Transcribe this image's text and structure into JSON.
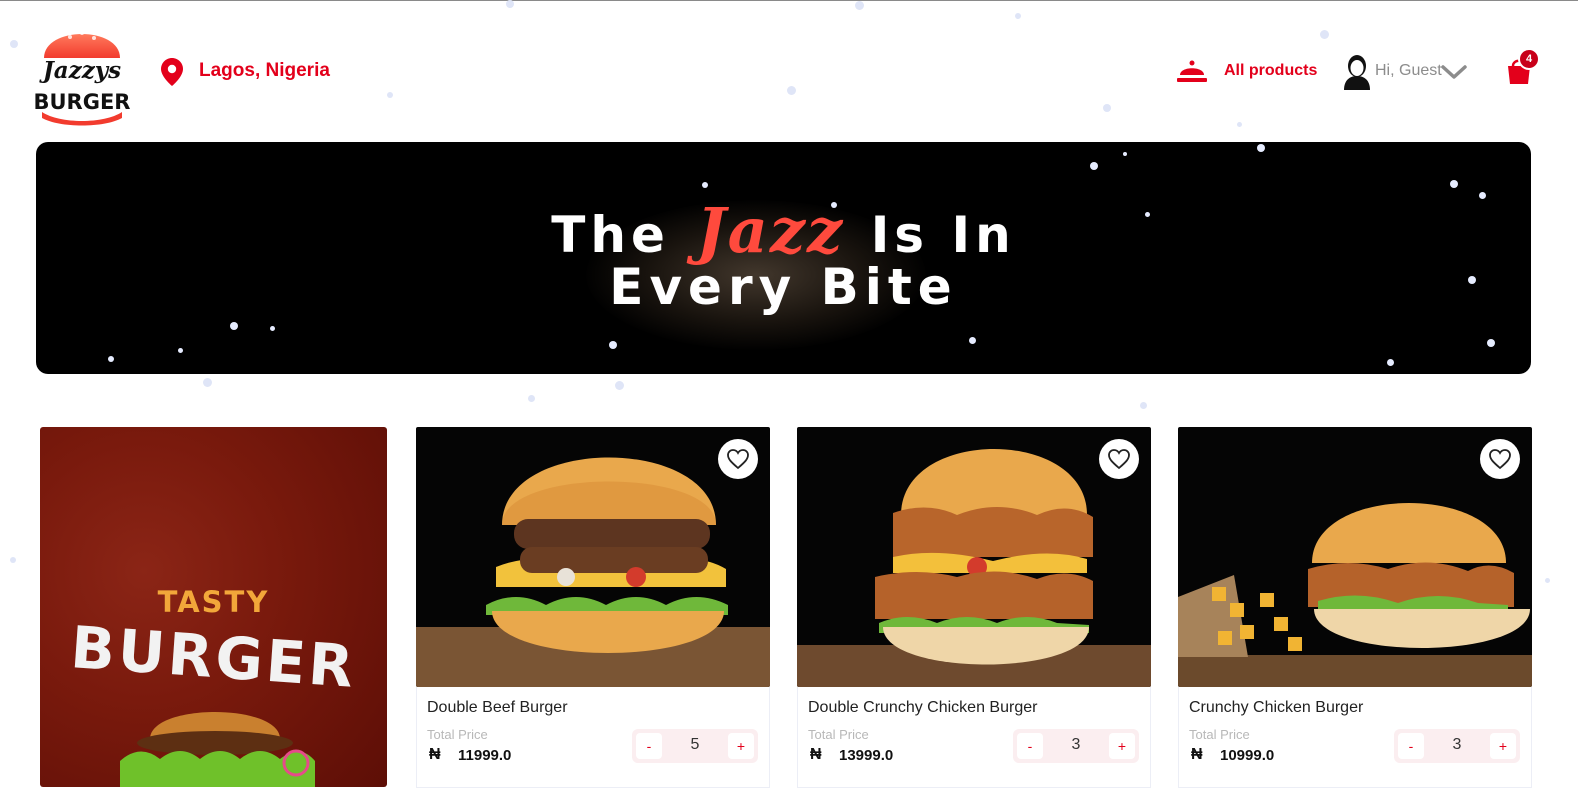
{
  "header": {
    "logo_script": "Jazzys",
    "logo_word": "BURGER",
    "location": "Lagos, Nigeria",
    "all_products": "All products",
    "greeting": "Hi, Guest",
    "cart_count": "4"
  },
  "hero": {
    "line1_pre": "The",
    "line1_accent": "Jazz",
    "line1_post": "Is In",
    "line2": "Every Bite"
  },
  "promo": {
    "tasty": "TASTY",
    "burger": "BURGER"
  },
  "products": [
    {
      "name": "Double Beef Burger",
      "price_label": "Total Price",
      "currency": "₦",
      "price": "11999.0",
      "qty_minus": "-",
      "qty": "5",
      "qty_plus": "+"
    },
    {
      "name": "Double Crunchy Chicken Burger",
      "price_label": "Total Price",
      "currency": "₦",
      "price": "13999.0",
      "qty_minus": "-",
      "qty": "3",
      "qty_plus": "+"
    },
    {
      "name": "Crunchy Chicken Burger",
      "price_label": "Total Price",
      "currency": "₦",
      "price": "10999.0",
      "qty_minus": "-",
      "qty": "3",
      "qty_plus": "+"
    }
  ],
  "colors": {
    "brand_red": "#e3001b",
    "accent_jazz": "#ff4a3d",
    "badge": "#c8001a",
    "promo_bg": "#7a1a0d"
  },
  "icons": [
    "location-pin-icon",
    "bell-icon",
    "user-avatar-icon",
    "chevron-down-icon",
    "cart-icon",
    "heart-icon"
  ]
}
